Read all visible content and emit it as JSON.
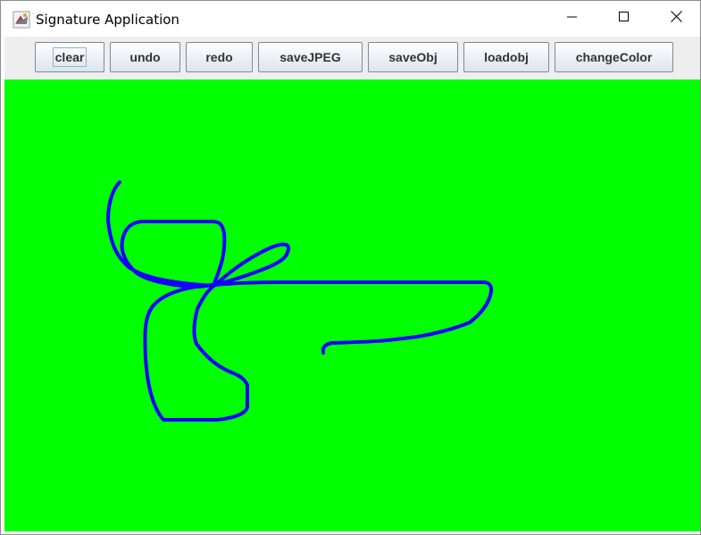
{
  "window": {
    "title": "Signature Application",
    "icon": "java-app-icon"
  },
  "title_controls": {
    "minimize_icon": "minimize-icon",
    "maximize_icon": "maximize-icon",
    "close_icon": "close-icon"
  },
  "toolbar": {
    "buttons": [
      {
        "label": "clear",
        "focused": true
      },
      {
        "label": "undo"
      },
      {
        "label": "redo"
      },
      {
        "label": "saveJPEG"
      },
      {
        "label": "saveObj"
      },
      {
        "label": "loadobj"
      },
      {
        "label": "changeColor"
      }
    ]
  },
  "canvas": {
    "background_color": "#00ff00",
    "stroke_color": "#1400ff"
  }
}
